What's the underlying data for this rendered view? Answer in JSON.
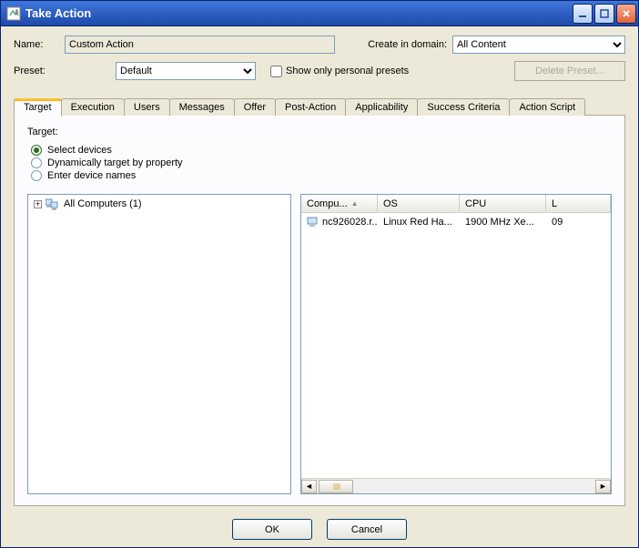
{
  "window": {
    "title": "Take Action"
  },
  "form": {
    "name_label": "Name:",
    "name_value": "Custom Action",
    "domain_label": "Create in domain:",
    "domain_value": "All Content",
    "preset_label": "Preset:",
    "preset_value": "Default",
    "show_personal_label": "Show only personal presets",
    "delete_preset_label": "Delete Preset..."
  },
  "tabs": [
    "Target",
    "Execution",
    "Users",
    "Messages",
    "Offer",
    "Post-Action",
    "Applicability",
    "Success Criteria",
    "Action Script"
  ],
  "target": {
    "heading": "Target:",
    "radios": [
      "Select devices",
      "Dynamically target by property",
      "Enter device names"
    ],
    "selected_radio": 0,
    "tree_root": "All Computers (1)"
  },
  "list": {
    "columns": [
      "Compu...",
      "OS",
      "CPU",
      "L"
    ],
    "row": {
      "computer": "nc926028.r...",
      "os": "Linux Red Ha...",
      "cpu": "1900 MHz Xe...",
      "last": "09"
    }
  },
  "buttons": {
    "ok": "OK",
    "cancel": "Cancel"
  }
}
